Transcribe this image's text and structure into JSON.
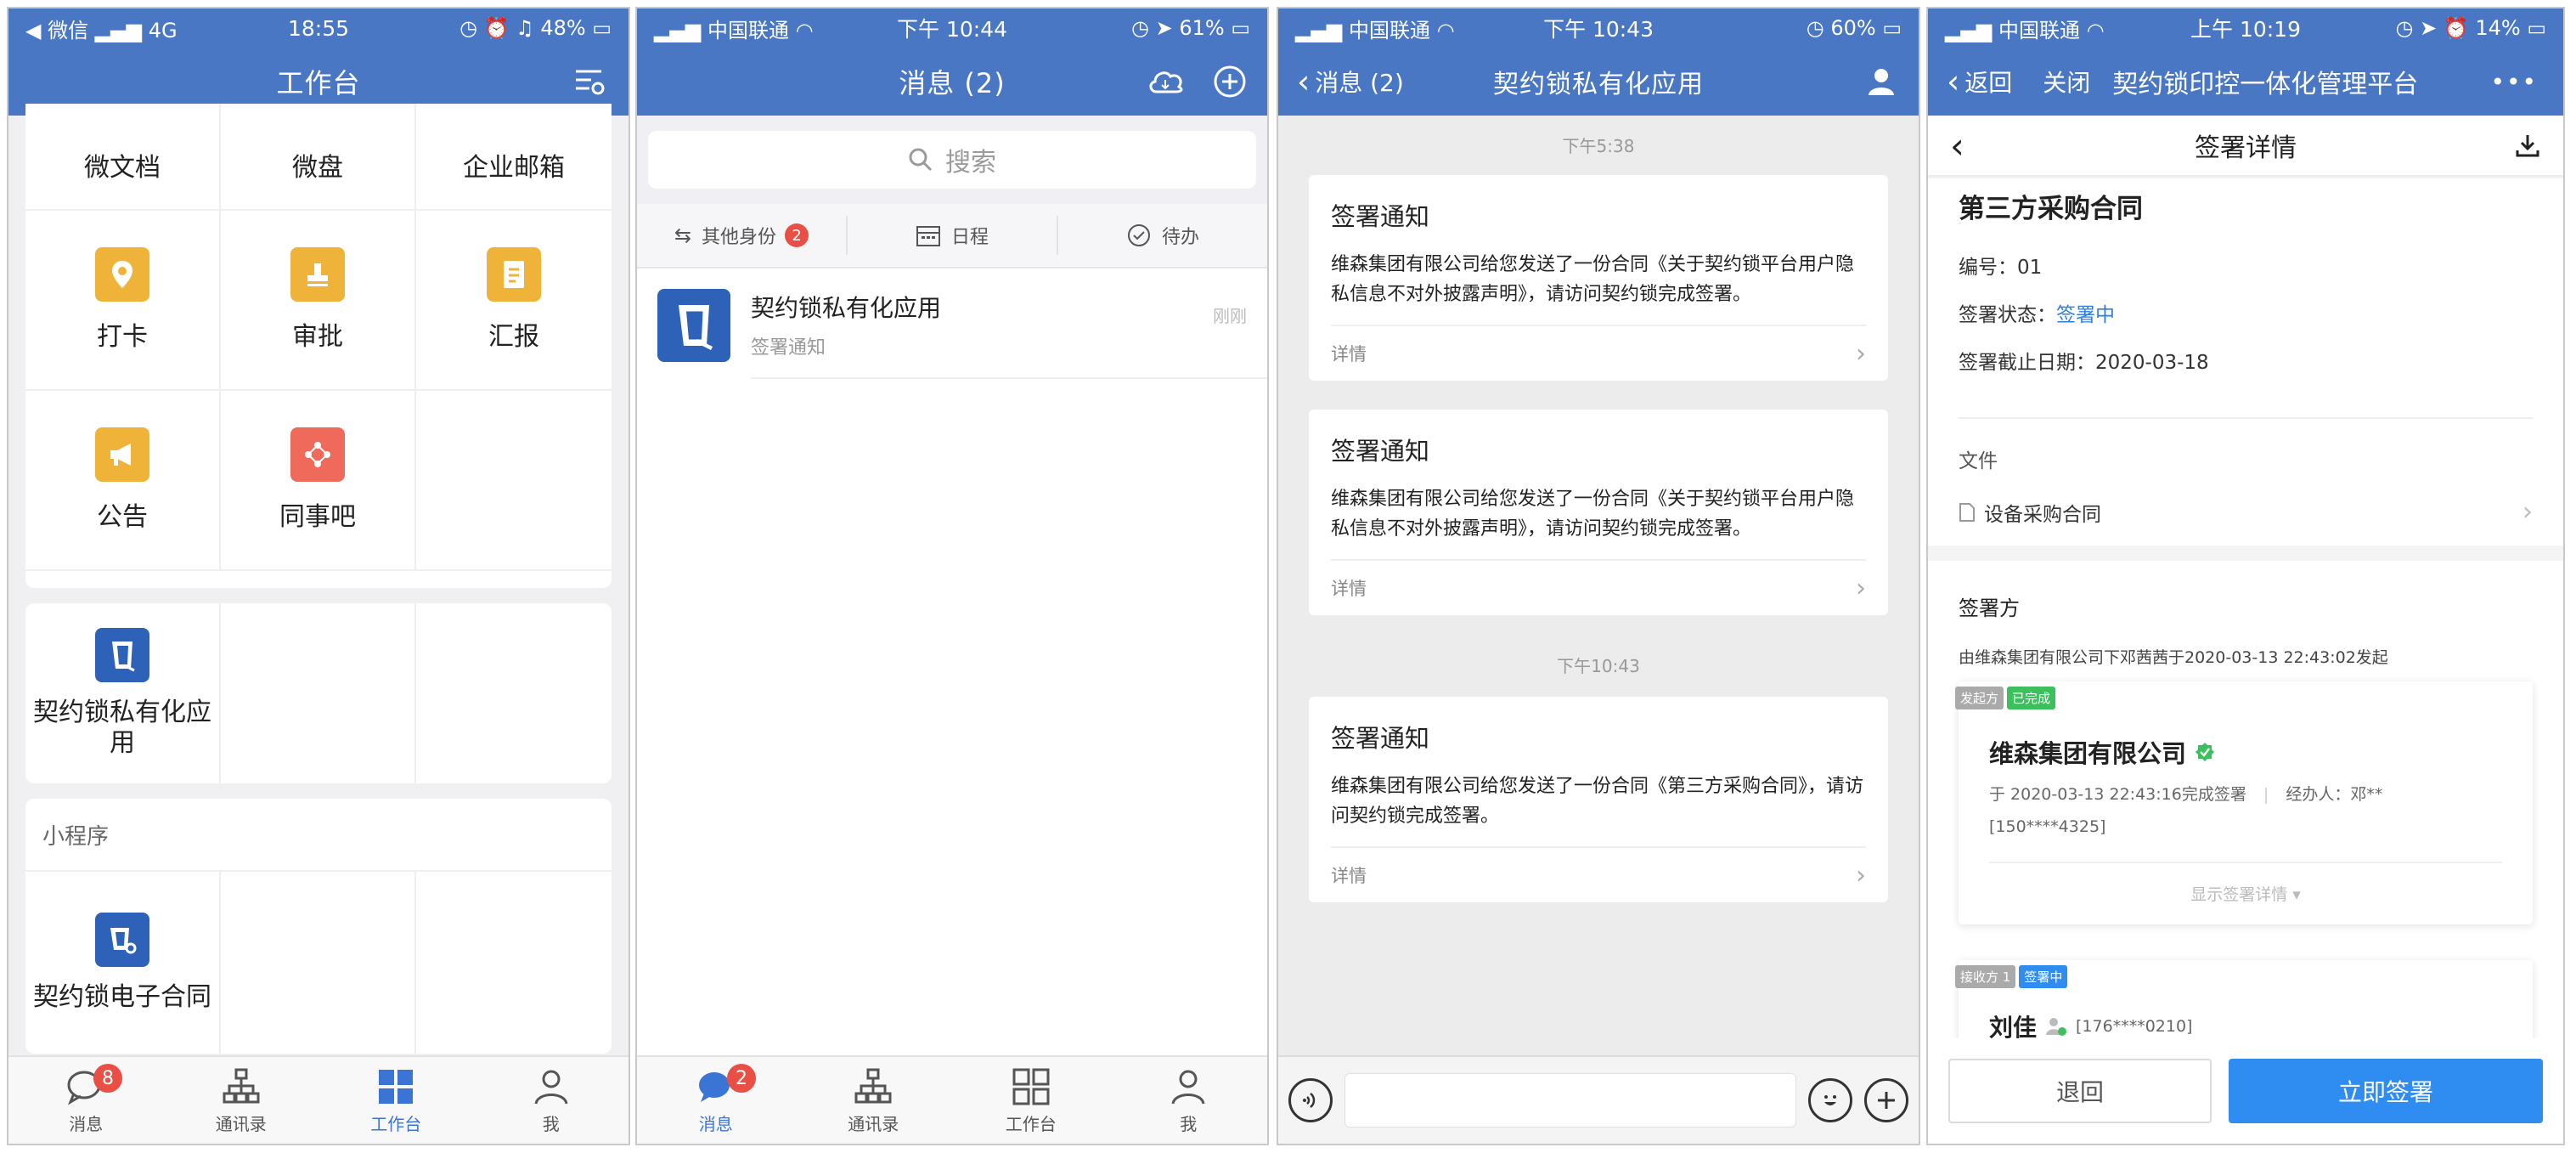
{
  "colors": {
    "header": "#4a77c4",
    "accent": "#3a74d4",
    "sign_button": "#2f8cf0",
    "badge": "#e94f45",
    "done_tag": "#3cbf5c",
    "signing_tag": "#2f8cf0"
  },
  "p1": {
    "status": {
      "left": "◀ 微信 ",
      "carrier": "4G",
      "time": "18:55",
      "battery": "48%"
    },
    "title": "工作台",
    "top_row": [
      "微文档",
      "微盘",
      "企业邮箱"
    ],
    "apps": [
      {
        "label": "打卡",
        "icon": "location-pin-icon"
      },
      {
        "label": "审批",
        "icon": "stamp-icon"
      },
      {
        "label": "汇报",
        "icon": "report-icon"
      },
      {
        "label": "公告",
        "icon": "megaphone-icon"
      },
      {
        "label": "同事吧",
        "icon": "share-icon"
      }
    ],
    "custom_app": "契约锁私有化应用",
    "mini_section": "小程序",
    "mini_app": "契约锁电子合同",
    "tabs": [
      {
        "label": "消息",
        "badge": "8"
      },
      {
        "label": "通讯录"
      },
      {
        "label": "工作台"
      },
      {
        "label": "我"
      }
    ]
  },
  "p2": {
    "status": {
      "carrier": "中国联通",
      "time": "下午 10:44",
      "battery": "61%"
    },
    "title": "消息 (2)",
    "search_placeholder": "搜索",
    "filters": [
      {
        "label": "其他身份",
        "badge": "2"
      },
      {
        "label": "日程"
      },
      {
        "label": "待办"
      }
    ],
    "message": {
      "title": "契约锁私有化应用",
      "subtitle": "签署通知",
      "time": "刚刚"
    },
    "tabs": [
      {
        "label": "消息",
        "badge": "2"
      },
      {
        "label": "通讯录"
      },
      {
        "label": "工作台"
      },
      {
        "label": "我"
      }
    ]
  },
  "p3": {
    "status": {
      "carrier": "中国联通",
      "time": "下午 10:43",
      "battery": "60%"
    },
    "back": "消息 (2)",
    "title": "契约锁私有化应用",
    "times": [
      "下午5:38",
      "下午10:43"
    ],
    "cards": [
      {
        "title": "签署通知",
        "body": "维森集团有限公司给您发送了一份合同《关于契约锁平台用户隐私信息不对外披露声明》，请访问契约锁完成签署。",
        "link": "详情"
      },
      {
        "title": "签署通知",
        "body": "维森集团有限公司给您发送了一份合同《关于契约锁平台用户隐私信息不对外披露声明》，请访问契约锁完成签署。",
        "link": "详情"
      },
      {
        "title": "签署通知",
        "body": "维森集团有限公司给您发送了一份合同《第三方采购合同》，请访问契约锁完成签署。",
        "link": "详情"
      }
    ]
  },
  "p4": {
    "status": {
      "carrier": "中国联通",
      "time": "上午 10:19",
      "battery": "14%"
    },
    "back": "返回",
    "close": "关闭",
    "title": "契约锁印控一体化管理平台",
    "more": "•••",
    "subtitle": "签署详情",
    "contract_title": "第三方采购合同",
    "number_label": "编号：",
    "number": "01",
    "status_label": "签署状态：",
    "status_value": "签署中",
    "deadline_label": "签署截止日期：",
    "deadline": "2020-03-18",
    "file_section": "文件",
    "file_name": "设备采购合同",
    "signers_section": "签署方",
    "initiated_by": "由维森集团有限公司下邓茜茜于2020-03-13 22:43:02发起",
    "party1": {
      "tag_role": "发起方",
      "tag_state": "已完成",
      "name": "维森集团有限公司",
      "detail": "于 2020-03-13 22:43:16完成签署",
      "handler": "经办人：邓**",
      "phone": "[150****4325]",
      "toggle": "显示签署详情"
    },
    "party2": {
      "tag_role": "接收方 1",
      "tag_state": "签署中",
      "name": "刘佳",
      "phone": "[176****0210]"
    },
    "btn_back": "退回",
    "btn_sign": "立即签署"
  }
}
